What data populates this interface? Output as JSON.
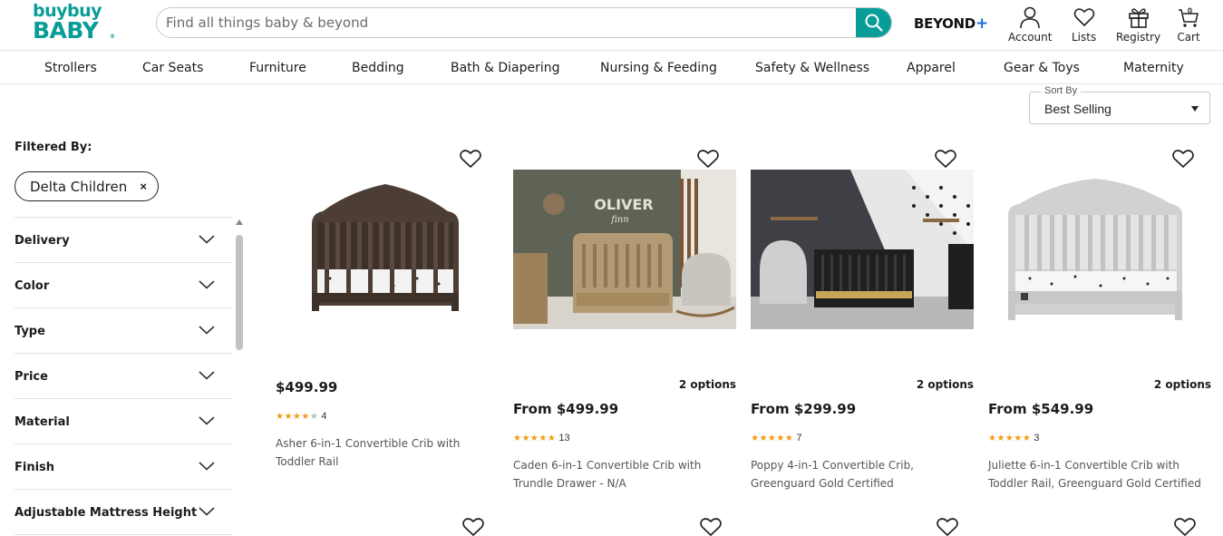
{
  "brand": {
    "line1": "buybuy",
    "line2": "BABY",
    "tm": "®",
    "color": "#0a9d98"
  },
  "search": {
    "placeholder": "Find all things baby & beyond",
    "value": ""
  },
  "header": {
    "beyond_label": "BEYOND",
    "beyond_plus": "+",
    "account_label": "Account",
    "lists_label": "Lists",
    "registry_label": "Registry",
    "cart_label": "Cart",
    "cart_count": "0"
  },
  "categories": [
    "Strollers",
    "Car Seats",
    "Furniture",
    "Bedding",
    "Bath & Diapering",
    "Nursing & Feeding",
    "Safety & Wellness",
    "Apparel",
    "Gear & Toys",
    "Maternity"
  ],
  "sort": {
    "legend": "Sort By",
    "value": "Best Selling"
  },
  "filters": {
    "heading": "Filtered By:",
    "active_chip": "Delta Children",
    "chip_close": "×",
    "groups": [
      "Delivery",
      "Color",
      "Type",
      "Price",
      "Material",
      "Finish",
      "Adjustable Mattress Height"
    ]
  },
  "products": [
    {
      "price": "$499.99",
      "options": "",
      "rating": 4,
      "reviews": "4",
      "title": "Asher 6-in-1 Convertible Crib with Toddler Rail"
    },
    {
      "price": "From $499.99",
      "options": "2 options",
      "rating": 5,
      "reviews": "13",
      "title": "Caden 6-in-1 Convertible Crib with Trundle Drawer - N/A",
      "image_text": "OLIVER",
      "image_text2": "finn"
    },
    {
      "price": "From $299.99",
      "options": "2 options",
      "rating": 5,
      "reviews": "7",
      "title": "Poppy 4-in-1 Convertible Crib, Greenguard Gold Certified"
    },
    {
      "price": "From $549.99",
      "options": "2 options",
      "rating": 5,
      "reviews": "3",
      "title": "Juliette 6-in-1 Convertible Crib with Toddler Rail, Greenguard Gold Certified"
    }
  ],
  "colors": {
    "accent": "#0a9d98",
    "star": "#f39c12",
    "beyond_plus": "#1e6fd9"
  }
}
